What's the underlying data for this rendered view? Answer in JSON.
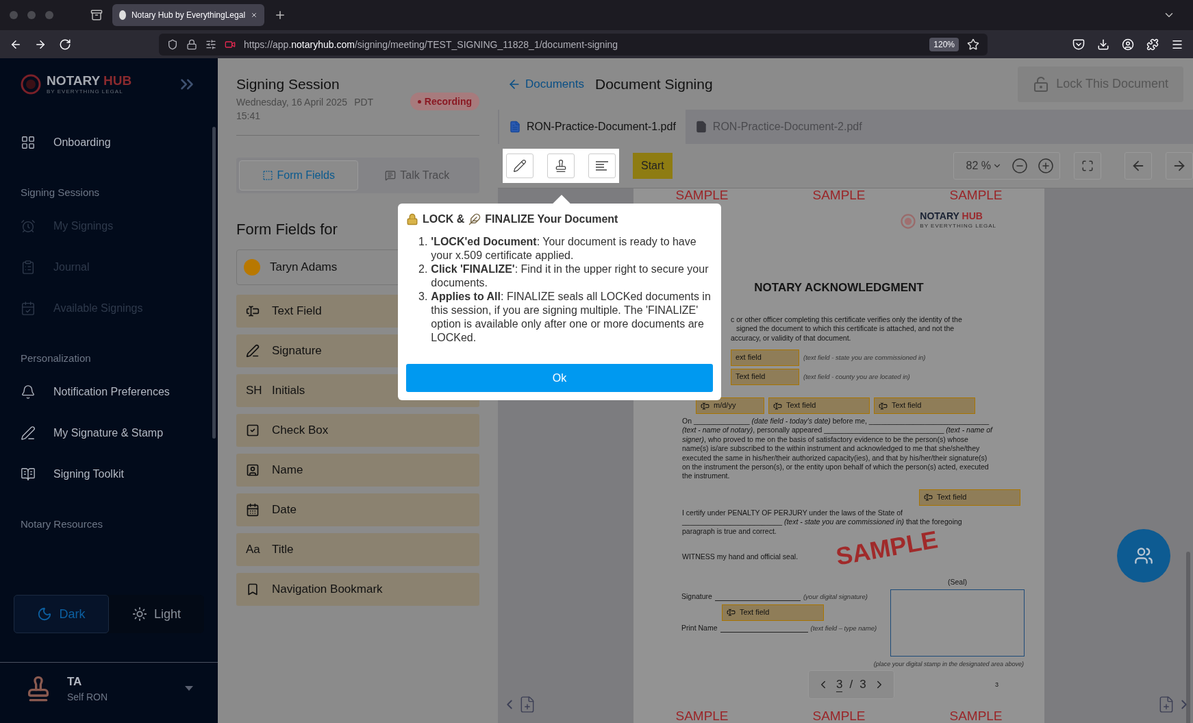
{
  "browser": {
    "tab_title": "Notary Hub by EverythingLegal",
    "url_start": "https://app.",
    "url_domain": "notaryhub.com",
    "url_path": "/signing/meeting/TEST_SIGNING_11828_1/document-signing",
    "zoom": "120%"
  },
  "sidebar": {
    "logo": {
      "word_1": "NOTARY",
      "word_2": "HUB",
      "tagline": "BY EVERYTHING LEGAL"
    },
    "items": [
      {
        "kind": "item",
        "label": "Onboarding",
        "disabled": false
      },
      {
        "kind": "section",
        "label": "Signing Sessions"
      },
      {
        "kind": "item",
        "label": "My Signings",
        "disabled": true
      },
      {
        "kind": "item",
        "label": "Journal",
        "disabled": true
      },
      {
        "kind": "item",
        "label": "Available Signings",
        "disabled": true
      },
      {
        "kind": "section",
        "label": "Personalization"
      },
      {
        "kind": "item",
        "label": "Notification Preferences",
        "disabled": false
      },
      {
        "kind": "item",
        "label": "My Signature & Stamp",
        "disabled": false
      },
      {
        "kind": "item",
        "label": "Signing Toolkit",
        "disabled": false
      },
      {
        "kind": "section",
        "label": "Notary Resources"
      }
    ],
    "theme": [
      {
        "label": "Dark",
        "selected": true
      },
      {
        "label": "Light",
        "selected": false
      }
    ],
    "user": {
      "initials": "TA",
      "role": "Self RON"
    }
  },
  "session": {
    "title": "Signing Session",
    "date": "Wednesday, 16 April 2025",
    "timezone": "PDT",
    "time": "15:41",
    "recording": "Recording"
  },
  "panel_tabs": [
    {
      "label": "Form Fields",
      "selected": true
    },
    {
      "label": "Talk Track",
      "selected": false
    }
  ],
  "form_fields_title": "Form Fields for",
  "signer": {
    "name": "Taryn Adams",
    "color": "#b87800"
  },
  "field_types": [
    {
      "label": "Text Field"
    },
    {
      "label": "Signature"
    },
    {
      "label": "Initials",
      "glyph": "SH"
    },
    {
      "label": "Check Box"
    },
    {
      "label": "Name"
    },
    {
      "label": "Date"
    },
    {
      "label": "Title",
      "glyph": "Aa"
    },
    {
      "label": "Navigation Bookmark"
    }
  ],
  "header": {
    "back": "Documents",
    "title": "Document Signing",
    "lock": "Lock This Document"
  },
  "doc_tabs": [
    {
      "label": "RON-Practice-Document-1.pdf",
      "selected": true
    },
    {
      "label": "RON-Practice-Document-2.pdf",
      "selected": false
    }
  ],
  "toolbar": {
    "start": "Start",
    "zoom": "82 %"
  },
  "popup": {
    "title_1": "LOCK &",
    "title_2": "FINALIZE Your Document",
    "items": [
      {
        "number": "1.",
        "text": "**'LOCK'ed Document**: Your document is ready to have your x.509 certificate applied."
      },
      {
        "number": "2.",
        "text": "**Click 'FINALIZE'**: Find it in the upper right to secure your documents."
      },
      {
        "number": "3.",
        "text": "**Applies to All**: FINALIZE seals all LOCKed documents in this session, if you are signing multiple. The 'FINALIZE' option is available only after one or more documents are LOCKed."
      }
    ],
    "button": "Ok"
  },
  "document": {
    "samples_top": [
      "SAMPLE",
      "SAMPLE",
      "SAMPLE"
    ],
    "logo": {
      "word_1": "NOTARY",
      "word_2": "HUB",
      "tagline": "BY EVERYTHING LEGAL"
    },
    "heading": "NOTARY ACKNOWLEDGMENT",
    "intro_lines": [
      "c or other officer completing this certificate verifies only the identity of the",
      "signed the document to which this certificate is attached, and not the",
      "accuracy, or validity of that document."
    ],
    "hint_lines": [
      "*(text field - state you are commissioned in)*",
      "*(text field - county you are located in)*"
    ],
    "paragraph": "On ______________ *(date field - today's date)* before me, ______________________________ *(text - name of notary)*, personally appeared ______________________________ *(text - name of signer)*, who proved to me on the basis of satisfactory evidence to be the person(s) whose name(s) is/are subscribed to the within instrument and acknowledged to me that she/she/they executed the same in his/her/their authorized capacity(ies), and that by his/her/their signature(s) on the instrument the person(s), or the entity upon behalf of which the person(s) acted, executed the instrument.",
    "certify": "I certify under PENALTY OF PERJURY under the laws of the State of _________________________ *(text - state you are commissioned in)* that the foregoing paragraph is true and correct.",
    "witness": "WITNESS my hand and official seal.",
    "signature_label": "Signature",
    "signature_hint": "(your digital signature)",
    "seal": "(Seal)",
    "print_name_label": "Print Name",
    "print_name_hint": "(text field – type name)",
    "stamp_hint": "(place your digital stamp in the designated area above)",
    "page_number": "3",
    "watermark": "SAMPLE",
    "samples_bottom": [
      "SAMPLE",
      "SAMPLE",
      "SAMPLE"
    ],
    "fields": [
      {
        "label": "ext field",
        "icon": false
      },
      {
        "label": "Text field",
        "icon": false
      },
      {
        "label": "m/d/yy",
        "icon": true
      },
      {
        "label": "Text field",
        "icon": true
      },
      {
        "label": "Text field",
        "icon": true
      },
      {
        "label": "Text field",
        "icon": true
      },
      {
        "label": "Text field",
        "icon": true
      }
    ]
  },
  "pager": {
    "current": "3",
    "separator": "/",
    "total": "3"
  }
}
